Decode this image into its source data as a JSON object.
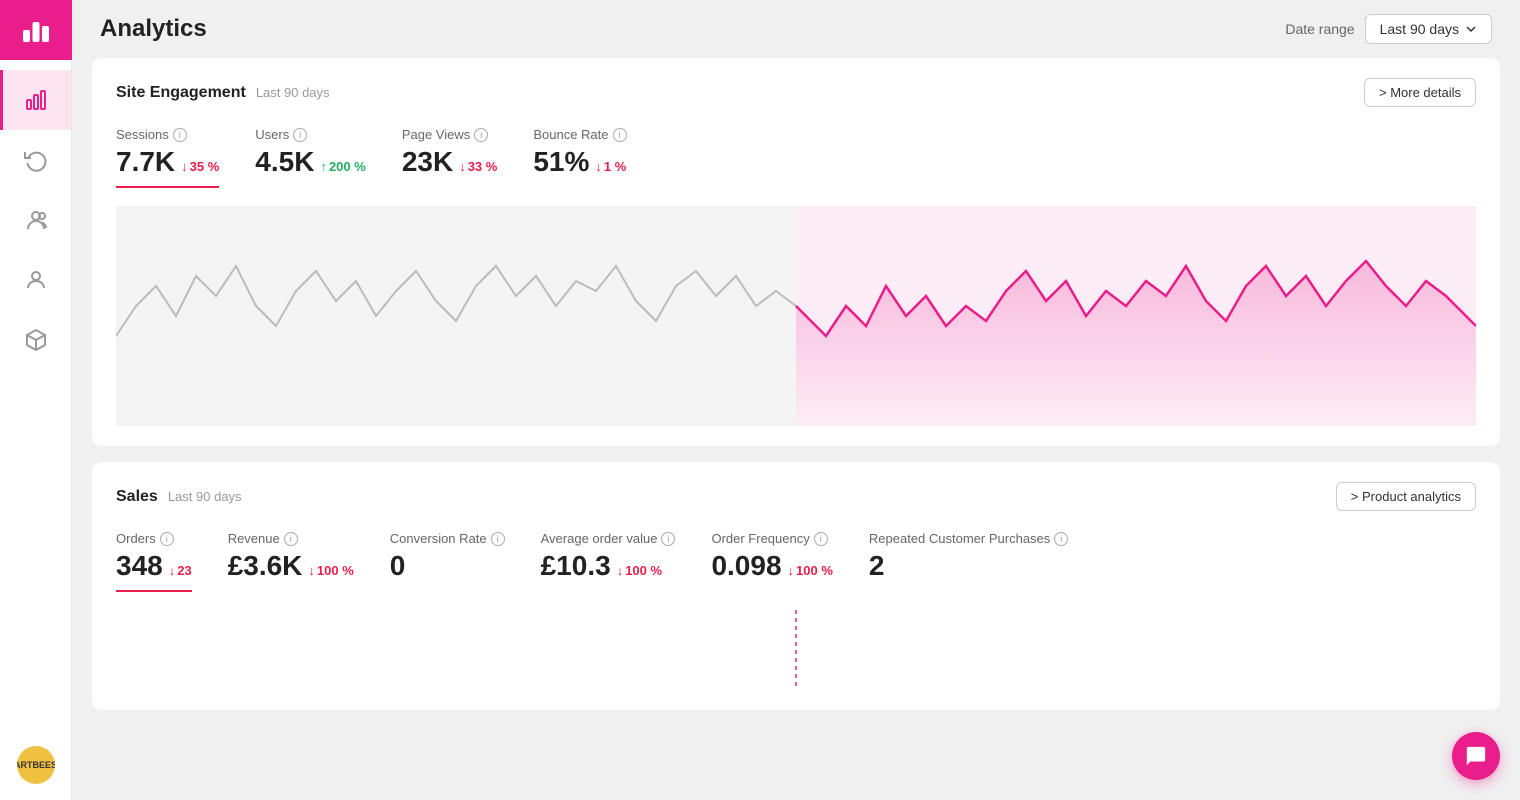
{
  "header": {
    "title": "Analytics",
    "date_range_label": "Date range",
    "date_range_value": "Last 90 days"
  },
  "sidebar": {
    "logo_alt": "Analytics logo",
    "items": [
      {
        "name": "analytics",
        "label": "Analytics",
        "active": true
      },
      {
        "name": "refresh",
        "label": "Refresh",
        "active": false
      },
      {
        "name": "audience",
        "label": "Audience",
        "active": false
      },
      {
        "name": "profile",
        "label": "Profile",
        "active": false
      },
      {
        "name": "products",
        "label": "Products",
        "active": false
      }
    ],
    "avatar_text": "ARTBEES"
  },
  "site_engagement": {
    "section_title": "Site Engagement",
    "section_subtitle": "Last 90 days",
    "action_label": "> More details",
    "metrics": [
      {
        "label": "Sessions",
        "value": "7.7K",
        "change": "35 %",
        "direction": "down",
        "underline": true
      },
      {
        "label": "Users",
        "value": "4.5K",
        "change": "200 %",
        "direction": "up",
        "underline": false
      },
      {
        "label": "Page Views",
        "value": "23K",
        "change": "33 %",
        "direction": "down",
        "underline": false
      },
      {
        "label": "Bounce Rate",
        "value": "51%",
        "change": "1 %",
        "direction": "down",
        "underline": false
      }
    ]
  },
  "sales": {
    "section_title": "Sales",
    "section_subtitle": "Last 90 days",
    "action_label": "> Product analytics",
    "metrics": [
      {
        "label": "Orders",
        "value": "348",
        "change": "23",
        "direction": "down",
        "underline": true
      },
      {
        "label": "Revenue",
        "value": "£3.6K",
        "change": "100 %",
        "direction": "down",
        "underline": false
      },
      {
        "label": "Conversion Rate",
        "value": "0",
        "change": "",
        "direction": "none",
        "underline": false
      },
      {
        "label": "Average order value",
        "value": "£10.3",
        "change": "100 %",
        "direction": "down",
        "underline": false
      },
      {
        "label": "Order Frequency",
        "value": "0.098",
        "change": "100 %",
        "direction": "down",
        "underline": false
      },
      {
        "label": "Repeated Customer Purchases",
        "value": "2",
        "change": "",
        "direction": "none",
        "underline": false
      }
    ]
  },
  "colors": {
    "brand_pink": "#e91e8c",
    "up_green": "#22b060",
    "down_red": "#e91e4c",
    "chart_pink": "#e91e8c",
    "chart_gray": "#bbb",
    "chart_fill_pink": "rgba(233,30,140,0.12)"
  }
}
